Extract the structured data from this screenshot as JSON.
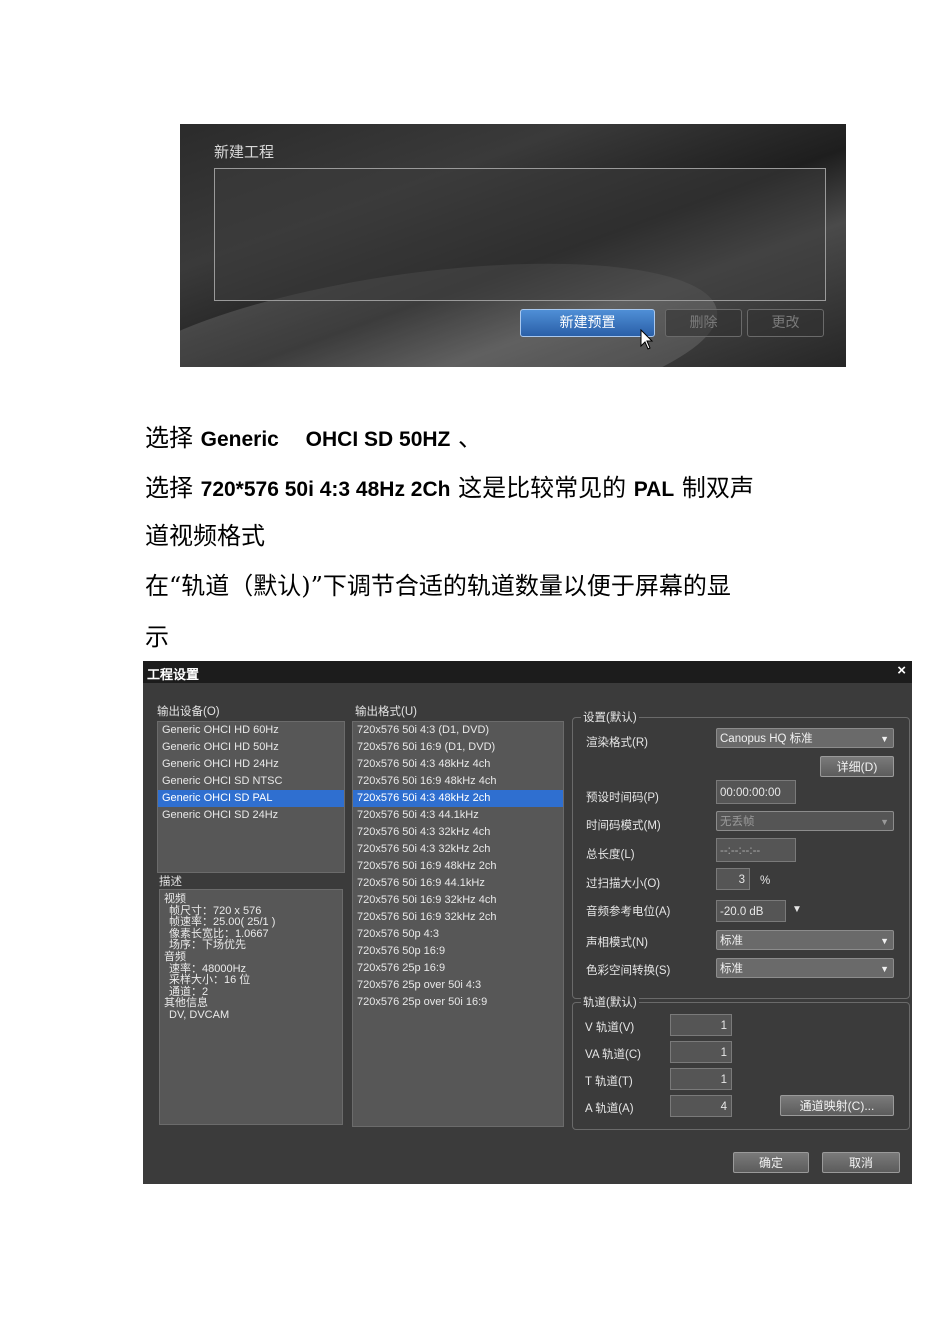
{
  "new_project_dialog": {
    "title": "新建工程",
    "buttons": {
      "new_preset": "新建预置",
      "delete": "删除",
      "modify": "更改"
    }
  },
  "text": {
    "line1_prefix": "选择 ",
    "line1_bold": "Generic　 OHCI SD 50HZ",
    "line1_suffix": " 、",
    "line2_prefix": "选择 ",
    "line2_bold": "720*576 50i 4:3 48Hz 2Ch",
    "line2_mid": " 这是比较常见的 ",
    "line2_bold2": "PAL",
    "line2_suffix": " 制双声",
    "line3": "道视频格式",
    "line4": "在“轨道（默认)”下调节合适的轨道数量以便于屏幕的显",
    "line5": "示"
  },
  "project_settings": {
    "title": "工程设置",
    "close": "×",
    "output_device_label": "输出设备(O)",
    "output_devices": [
      "Generic OHCI HD 60Hz",
      "Generic OHCI HD 50Hz",
      "Generic OHCI HD 24Hz",
      "Generic OHCI SD NTSC",
      "Generic OHCI SD PAL",
      "Generic OHCI SD 24Hz"
    ],
    "selected_device_index": 4,
    "description_label": "描述",
    "description_lines": [
      "视频",
      "帧尺寸：720 x 576",
      "帧速率：25.00( 25/1 )",
      "像素长宽比：1.0667",
      "场序：下场优先",
      "音频",
      "速率：48000Hz",
      "采样大小：16 位",
      "通道：2",
      "其他信息",
      "DV, DVCAM"
    ],
    "output_format_label": "输出格式(U)",
    "output_formats": [
      "720x576 50i 4:3 (D1, DVD)",
      "720x576 50i 16:9 (D1, DVD)",
      "720x576 50i 4:3 48kHz 4ch",
      "720x576 50i 16:9 48kHz 4ch",
      "720x576 50i 4:3 48kHz 2ch",
      "720x576 50i 4:3 44.1kHz",
      "720x576 50i 4:3 32kHz 4ch",
      "720x576 50i 4:3 32kHz 2ch",
      "720x576 50i 16:9 48kHz 2ch",
      "720x576 50i 16:9 44.1kHz",
      "720x576 50i 16:9 32kHz 4ch",
      "720x576 50i 16:9 32kHz 2ch",
      "720x576 50p 4:3",
      "720x576 50p 16:9",
      "720x576 25p 16:9",
      "720x576 25p over 50i 4:3",
      "720x576 25p over 50i 16:9"
    ],
    "selected_format_index": 4,
    "settings_group": {
      "title": "设置(默认)",
      "render_format_label": "渲染格式(R)",
      "render_format_value": "Canopus HQ 标准",
      "detail_button": "详细(D)",
      "preset_timecode_label": "预设时间码(P)",
      "preset_timecode_value": "00:00:00:00",
      "timecode_mode_label": "时间码模式(M)",
      "timecode_mode_value": "无丢帧",
      "total_length_label": "总长度(L)",
      "total_length_value": "--:--:--:--",
      "overscan_label": "过扫描大小(O)",
      "overscan_value": "3",
      "overscan_unit": "%",
      "audio_ref_label": "音频参考电位(A)",
      "audio_ref_value": "-20.0 dB",
      "phase_mode_label": "声相模式(N)",
      "phase_mode_value": "标准",
      "color_space_label": "色彩空间转换(S)",
      "color_space_value": "标准"
    },
    "tracks_group": {
      "title": "轨道(默认)",
      "v_label": "V 轨道(V)",
      "v_value": "1",
      "va_label": "VA 轨道(C)",
      "va_value": "1",
      "t_label": "T 轨道(T)",
      "t_value": "1",
      "a_label": "A 轨道(A)",
      "a_value": "4",
      "channel_map_button": "通道映射(C)..."
    },
    "ok_button": "确定",
    "cancel_button": "取消"
  }
}
